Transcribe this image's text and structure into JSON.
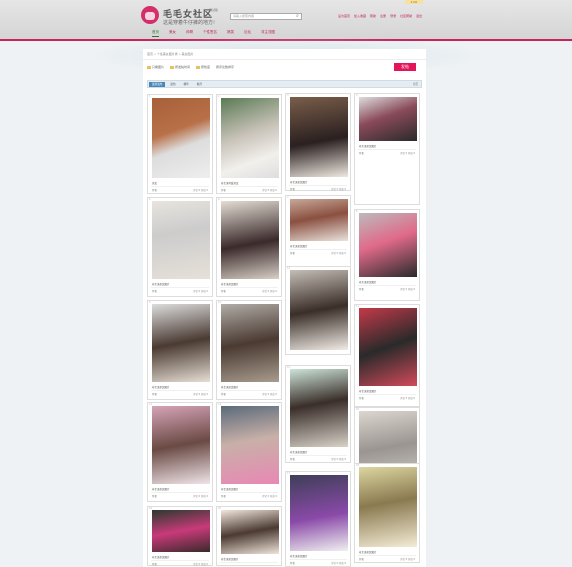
{
  "site": {
    "title": "毛毛女社区",
    "badge": "测试版",
    "slogan": "这是穿着牛仔裤的地方!",
    "search_placeholder": "请输入搜索内容",
    "search_button": "搜索",
    "top_links": [
      "设为首页",
      "加入收藏",
      "帮助",
      "注册",
      "登录",
      "社区帮助",
      "退出"
    ],
    "top_tag": "4.00"
  },
  "nav": {
    "items": [
      {
        "label": "首页",
        "active": true
      },
      {
        "label": "美女",
        "active": false
      },
      {
        "label": "帅哥",
        "active": false
      },
      {
        "label": "个性签名",
        "active": false
      },
      {
        "label": "搞笑",
        "active": false
      },
      {
        "label": "论坛",
        "active": false
      },
      {
        "label": "非主流图",
        "active": false
      }
    ]
  },
  "content": {
    "breadcrumb": "首页 » 个性美女图片秀 » 美女图片",
    "toolbar": [
      "只看图片",
      "按发帖时间",
      "按热度",
      "按评论数排序"
    ],
    "post_button": "发帖",
    "filter_tabs": [
      "最新发布",
      "最热",
      "精华",
      "推荐"
    ],
    "filter_right": "分页",
    "cards": [
      {
        "no": "1",
        "caption": "美女",
        "author": "作者",
        "meta": "评论 0  浏览 0"
      },
      {
        "no": "2",
        "caption": "非主流可爱美女",
        "author": "作者",
        "meta": "评论 0  浏览 0"
      },
      {
        "no": "3",
        "caption": "非主流美女图片",
        "author": "作者",
        "meta": "评论 0  浏览 0"
      },
      {
        "no": "4",
        "caption": "非主流美女图片",
        "author": "作者",
        "meta": "评论 0  浏览 0"
      },
      {
        "no": "5",
        "caption": "非主流美女图片",
        "author": "作者",
        "meta": "评论 0  浏览 0"
      },
      {
        "no": "6",
        "caption": "非主流美女图片",
        "author": "作者",
        "meta": "评论 0  浏览 0"
      },
      {
        "no": "7",
        "caption": "非主流美女图片",
        "author": "作者",
        "meta": "评论 0  浏览 0"
      },
      {
        "no": "8",
        "caption": "非主流美女图片",
        "author": "作者",
        "meta": "评论 0  浏览 0"
      },
      {
        "no": "9",
        "caption": "非主流美女图片",
        "author": "作者",
        "meta": "评论 0  浏览 0"
      },
      {
        "no": "10",
        "caption": "非主流美女图片",
        "author": "作者",
        "meta": "评论 0  浏览 0"
      },
      {
        "no": "11",
        "caption": "非主流美女图片",
        "author": "作者",
        "meta": "评论 0  浏览 0"
      },
      {
        "no": "12",
        "caption": "非主流美女图片",
        "author": "作者",
        "meta": "评论 0  浏览 0"
      },
      {
        "no": "13",
        "caption": "非主流美女图片",
        "author": "作者",
        "meta": "评论 0  浏览 0"
      },
      {
        "no": "14",
        "caption": "非主流美女图片",
        "author": "作者",
        "meta": "评论 0  浏览 0"
      },
      {
        "no": "15",
        "caption": "非主流美女图片",
        "author": "作者",
        "meta": "评论 0  浏览 0"
      },
      {
        "no": "16",
        "caption": "非主流美女图片",
        "author": "作者",
        "meta": "评论 0  浏览 0"
      },
      {
        "no": "17",
        "caption": "非主流美女图片",
        "author": "作者",
        "meta": "评论 0  浏览 0"
      },
      {
        "no": "18",
        "caption": "非主流美女图片",
        "author": "作者",
        "meta": "评论 0  浏览 0"
      },
      {
        "no": "19",
        "caption": "非主流美女图片",
        "author": "作者",
        "meta": "评论 0  浏览 0"
      },
      {
        "no": "20",
        "caption": "非主流美女图片",
        "author": "作者",
        "meta": "评论 0  浏览 0"
      }
    ]
  }
}
